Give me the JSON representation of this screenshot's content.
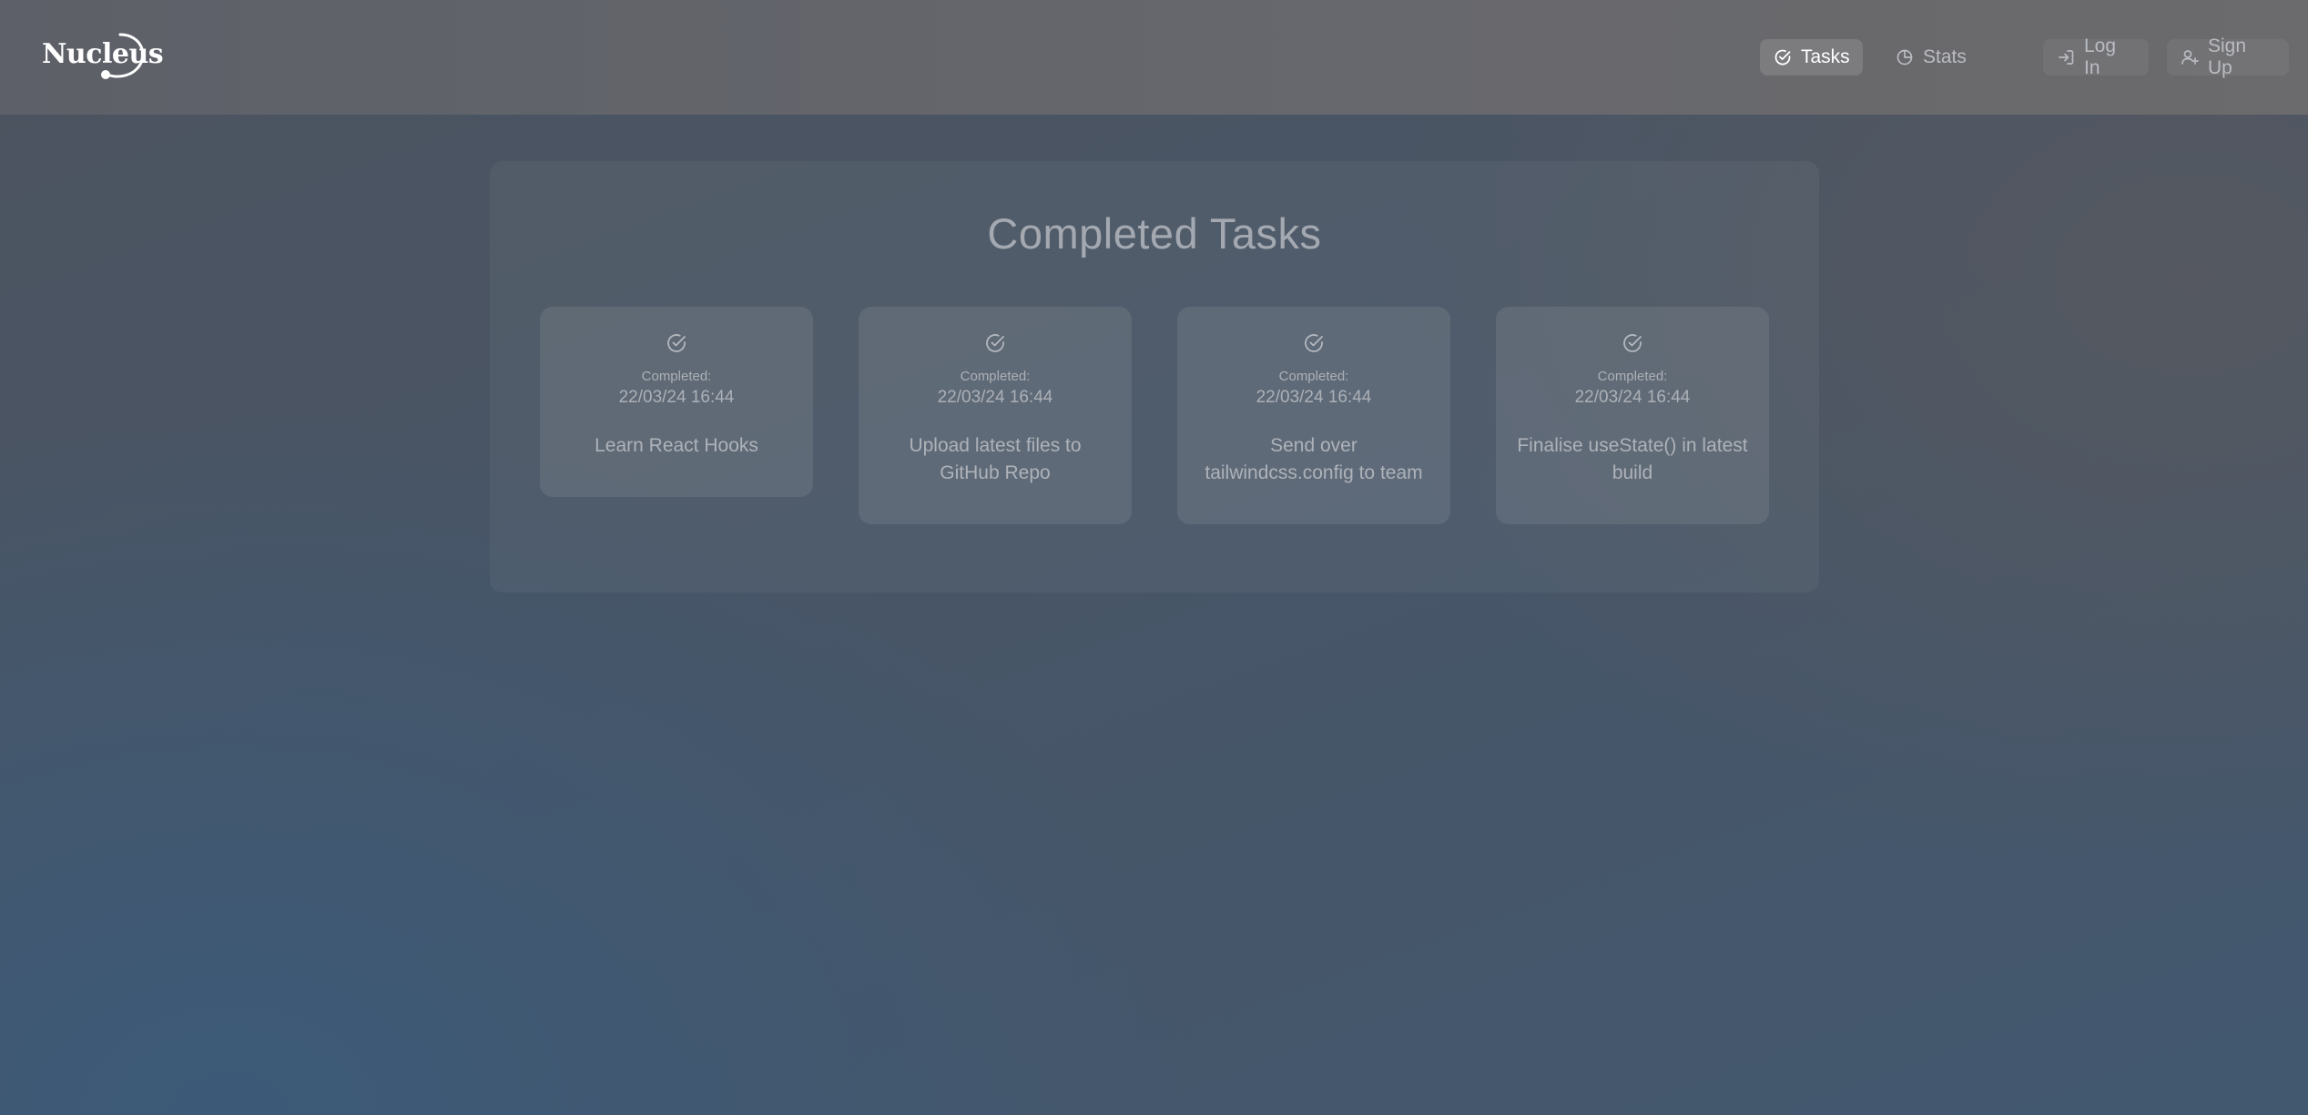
{
  "brand": {
    "logo_text": "Nucleus"
  },
  "nav": {
    "tasks_label": "Tasks",
    "stats_label": "Stats",
    "login_label": "Log In",
    "signup_label": "Sign Up"
  },
  "main": {
    "title": "Completed Tasks",
    "cards": [
      {
        "completed_label": "Completed:",
        "date": "22/03/24 16:44",
        "task": "Learn React Hooks",
        "icon": "check-circle-icon"
      },
      {
        "completed_label": "Completed:",
        "date": "22/03/24 16:44",
        "task": "Upload latest files to GitHub Repo",
        "icon": "check-circle-icon"
      },
      {
        "completed_label": "Completed:",
        "date": "22/03/24 16:44",
        "task": "Send over tailwindcss.config to team",
        "icon": "check-circle-icon"
      },
      {
        "completed_label": "Completed:",
        "date": "22/03/24 16:44",
        "task": "Finalise useState() in latest build",
        "icon": "check-circle-icon"
      }
    ]
  },
  "colors": {
    "accent_active_text": "#ffffff",
    "muted_text": "#aeb2b9",
    "header_bg": "#646569"
  }
}
